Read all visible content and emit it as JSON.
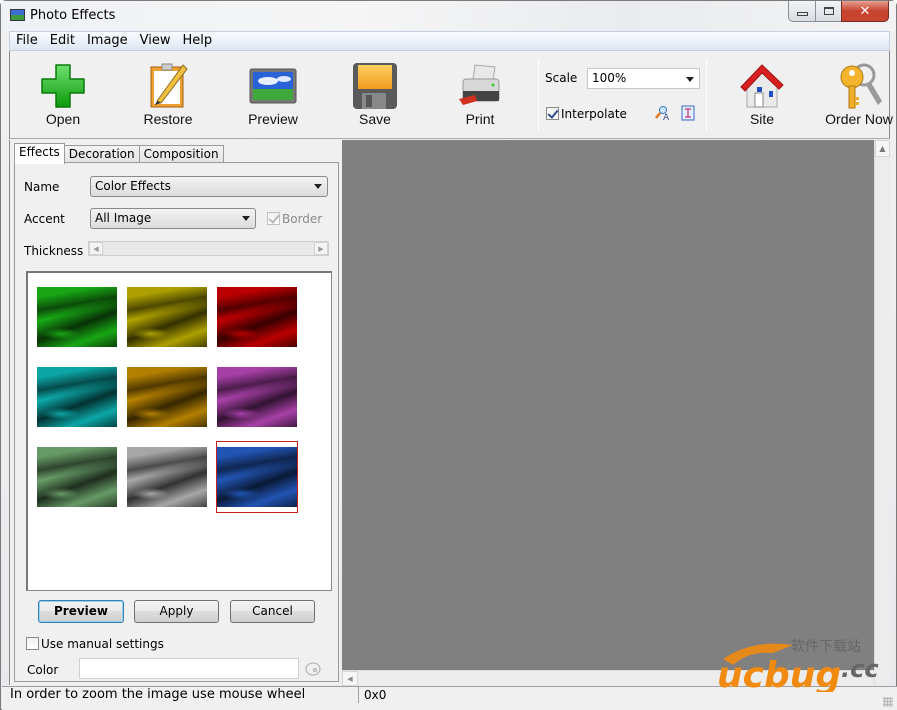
{
  "window": {
    "title": "Photo Effects",
    "app_icon": "photo-icon",
    "controls": {
      "minimize": "minimize-icon",
      "maximize": "maximize-icon",
      "close": "close-icon",
      "close_glyph": "✕"
    }
  },
  "menu": [
    "File",
    "Edit",
    "Image",
    "View",
    "Help"
  ],
  "toolbar": {
    "buttons": [
      {
        "label": "Open",
        "icon": "green-plus-icon"
      },
      {
        "label": "Restore",
        "icon": "clipboard-pencil-icon"
      },
      {
        "label": "Preview",
        "icon": "landscape-picture-icon"
      },
      {
        "label": "Save",
        "icon": "floppy-disk-icon"
      },
      {
        "label": "Print",
        "icon": "printer-icon"
      },
      {
        "label": "Site",
        "icon": "house-icon"
      },
      {
        "label": "Order Now",
        "icon": "keys-icon"
      }
    ],
    "scale": {
      "label": "Scale",
      "value": "100%"
    },
    "interpolate": {
      "label": "Interpolate",
      "checked": true
    },
    "extra_icons": [
      "zoom-text-icon",
      "fit-page-icon"
    ]
  },
  "left_panel": {
    "tabs": [
      {
        "label": "Effects",
        "active": true
      },
      {
        "label": "Decoration",
        "active": false
      },
      {
        "label": "Composition",
        "active": false
      }
    ],
    "name_label": "Name",
    "name_value": "Color Effects",
    "accent_label": "Accent",
    "accent_value": "All Image",
    "border_label": "Border",
    "border_checked": true,
    "border_enabled": false,
    "thickness_label": "Thickness",
    "thumbnails": [
      {
        "name": "green",
        "tint": "#1fd01a"
      },
      {
        "name": "yellow",
        "tint": "#d8c800"
      },
      {
        "name": "red",
        "tint": "#e80000"
      },
      {
        "name": "cyan",
        "tint": "#10d0d0"
      },
      {
        "name": "amber",
        "tint": "#e0a000"
      },
      {
        "name": "magenta",
        "tint": "#d050d0"
      },
      {
        "name": "pale-green",
        "tint": "#80c080"
      },
      {
        "name": "grayscale",
        "tint": "#d0d0d0"
      },
      {
        "name": "blue",
        "tint": "#2a6ae0"
      }
    ],
    "selected_thumbnail": 8,
    "buttons": {
      "preview": "Preview",
      "apply": "Apply",
      "cancel": "Cancel"
    },
    "manual_settings": {
      "label": "Use manual settings",
      "checked": false
    },
    "color_label": "Color",
    "color_value": ""
  },
  "canvas": {
    "background": "#808080"
  },
  "status": {
    "hint": "In order to zoom the image use mouse wheel",
    "size": "0x0"
  },
  "watermark": {
    "brand": "ucbug",
    "suffix": ".cc",
    "cn_text": "软件下载站"
  }
}
